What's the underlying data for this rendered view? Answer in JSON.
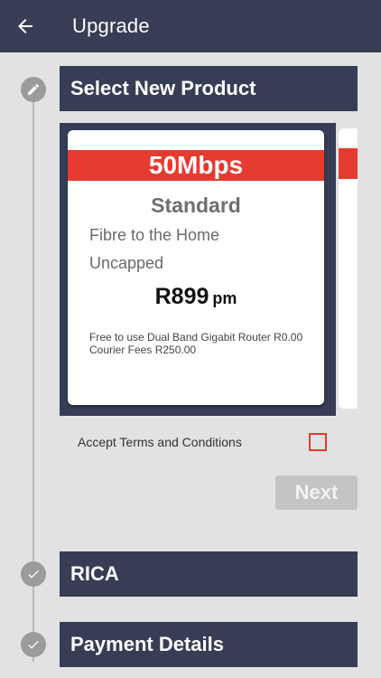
{
  "appbar": {
    "title": "Upgrade"
  },
  "steps": [
    {
      "label": "Select New Product",
      "icon": "pencil-icon"
    },
    {
      "label": "RICA",
      "icon": "check-icon"
    },
    {
      "label": "Payment Details",
      "icon": "check-icon"
    }
  ],
  "product": {
    "speed": "50Mbps",
    "tier": "Standard",
    "features": [
      "Fibre to the Home",
      "Uncapped"
    ],
    "price": "R899",
    "price_unit": "pm",
    "fineprint": [
      "Free to use Dual Band Gigabit Router R0.00",
      "Courier Fees R250.00"
    ]
  },
  "terms": {
    "label": "Accept Terms and Conditions",
    "checked": false
  },
  "next_button": {
    "label": "Next",
    "enabled": false
  },
  "colors": {
    "header": "#363d55",
    "accent": "#e53a2f",
    "background": "#e2e2e2",
    "step_icon": "#9b9b9b"
  }
}
